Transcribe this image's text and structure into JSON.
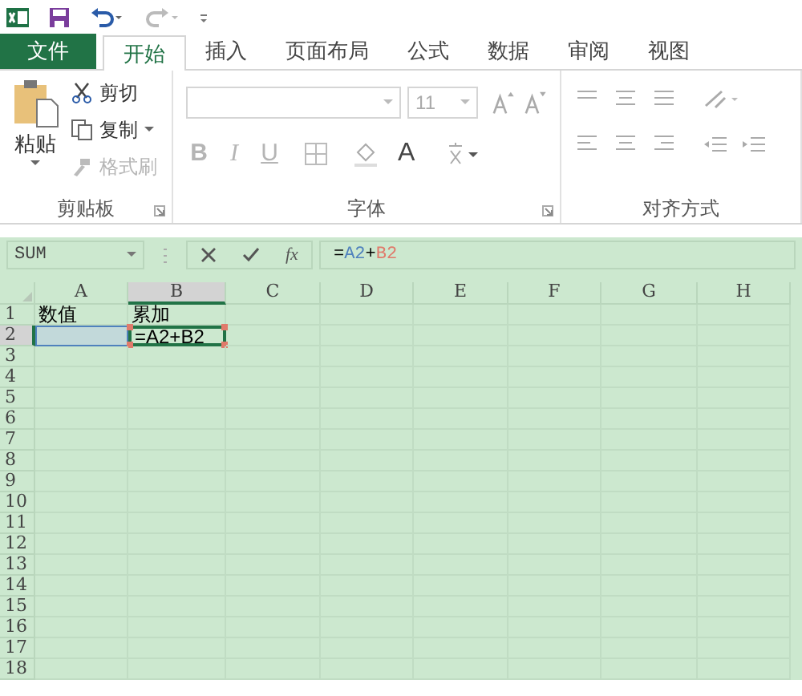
{
  "tabs": [
    {
      "label": "文件",
      "kind": "file"
    },
    {
      "label": "开始",
      "kind": "tab",
      "selected": true
    },
    {
      "label": "插入",
      "kind": "tab",
      "selected": false
    },
    {
      "label": "页面布局",
      "kind": "tab",
      "selected": false
    },
    {
      "label": "公式",
      "kind": "tab",
      "selected": false
    },
    {
      "label": "数据",
      "kind": "tab",
      "selected": false
    },
    {
      "label": "审阅",
      "kind": "tab",
      "selected": false
    },
    {
      "label": "视图",
      "kind": "tab",
      "selected": false
    }
  ],
  "clipboard": {
    "title": "剪贴板",
    "paste": "粘贴",
    "items": [
      {
        "label": "剪切",
        "disabled": false
      },
      {
        "label": "复制",
        "disabled": false
      },
      {
        "label": "格式刷",
        "disabled": true
      }
    ]
  },
  "font": {
    "title": "字体",
    "font_size": "11",
    "styles": [
      {
        "label": "B",
        "disabled": true
      },
      {
        "label": "I",
        "disabled": true
      },
      {
        "label": "U",
        "disabled": true
      }
    ],
    "font_color": {
      "label": "A",
      "disabled": false
    }
  },
  "alignment": {
    "title": "对齐方式"
  },
  "formula_bar": {
    "name_box": "SUM",
    "fx": "fx",
    "formula": [
      {
        "text": "=",
        "color": "#000000"
      },
      {
        "text": "A2",
        "color": "#4f81bd"
      },
      {
        "text": "+",
        "color": "#000000"
      },
      {
        "text": "B2",
        "color": "#e07a6b"
      }
    ]
  },
  "sheet": {
    "columns": [
      {
        "label": "A",
        "selected": false
      },
      {
        "label": "B",
        "selected": true
      },
      {
        "label": "C",
        "selected": false
      },
      {
        "label": "D",
        "selected": false
      },
      {
        "label": "E",
        "selected": false
      },
      {
        "label": "F",
        "selected": false
      },
      {
        "label": "G",
        "selected": false
      },
      {
        "label": "H",
        "selected": false
      }
    ],
    "rows": [
      {
        "header": "1",
        "selected": false,
        "cells": [
          {
            "text": "数值",
            "kind": "plain"
          },
          {
            "text": "累加",
            "kind": "plain"
          }
        ]
      },
      {
        "header": "2",
        "selected": true,
        "cells": [
          {
            "kind": "reference"
          },
          {
            "text": "=A2+B2",
            "kind": "editing"
          }
        ]
      },
      {
        "header": "3",
        "selected": false,
        "cells": []
      },
      {
        "header": "4",
        "selected": false,
        "cells": []
      },
      {
        "header": "5",
        "selected": false,
        "cells": []
      },
      {
        "header": "6",
        "selected": false,
        "cells": []
      },
      {
        "header": "7",
        "selected": false,
        "cells": []
      },
      {
        "header": "8",
        "selected": false,
        "cells": []
      },
      {
        "header": "9",
        "selected": false,
        "cells": []
      },
      {
        "header": "10",
        "selected": false,
        "cells": []
      },
      {
        "header": "11",
        "selected": false,
        "cells": []
      },
      {
        "header": "12",
        "selected": false,
        "cells": []
      },
      {
        "header": "13",
        "selected": false,
        "cells": []
      },
      {
        "header": "14",
        "selected": false,
        "cells": []
      },
      {
        "header": "15",
        "selected": false,
        "cells": []
      },
      {
        "header": "16",
        "selected": false,
        "cells": []
      },
      {
        "header": "17",
        "selected": false,
        "cells": []
      },
      {
        "header": "18",
        "selected": false,
        "cells": []
      }
    ]
  }
}
